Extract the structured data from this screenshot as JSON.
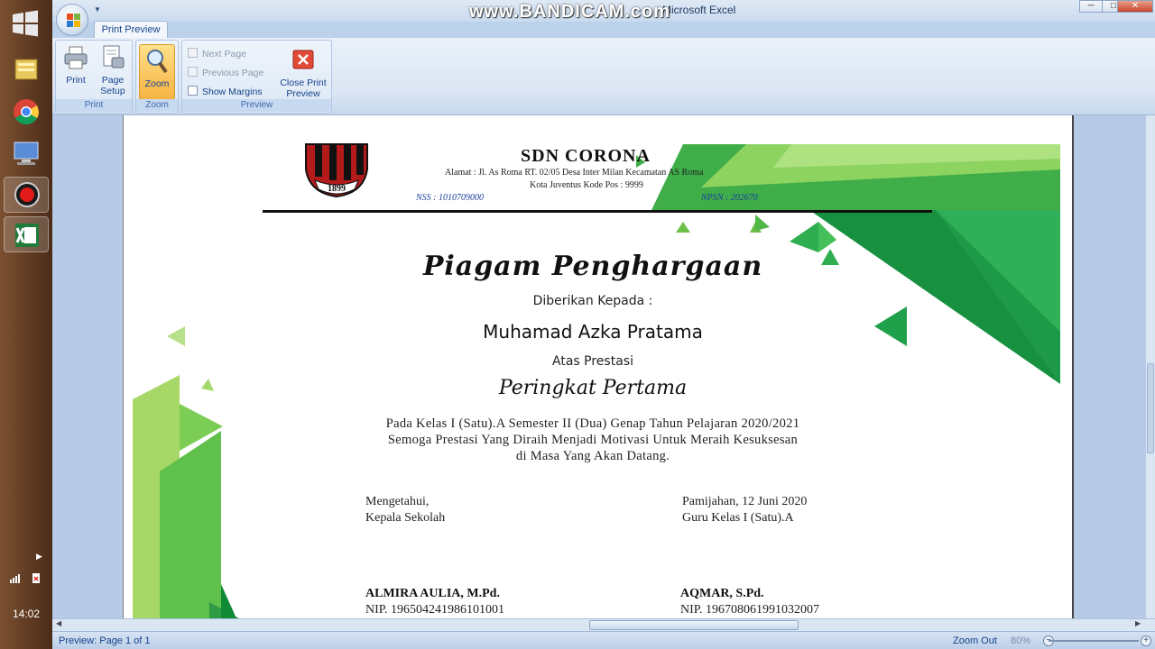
{
  "window": {
    "title": "Microsoft Excel",
    "overlay_watermark": "www.BANDICAM.com",
    "min_glyph": "─",
    "max_glyph": "□",
    "close_glyph": "✕"
  },
  "taskbar": {
    "clock": "14:02",
    "apps": [
      "file-manager-icon",
      "chrome-icon",
      "remote-desktop-icon",
      "record-icon",
      "excel-icon"
    ]
  },
  "ribbon": {
    "tab": "Print Preview",
    "groups": {
      "print": {
        "label": "Print",
        "print_btn": "Print",
        "page_setup_line1": "Page",
        "page_setup_line2": "Setup"
      },
      "zoom": {
        "label": "Zoom",
        "zoom_btn": "Zoom"
      },
      "preview": {
        "label": "Preview",
        "next_page": "Next Page",
        "previous_page": "Previous Page",
        "show_margins": "Show Margins",
        "close_line1": "Close Print",
        "close_line2": "Preview"
      }
    }
  },
  "certificate": {
    "school": "SDN CORONA",
    "address": "Alamat : Jl. As Roma RT. 02/05 Desa Inter Milan Kecamatan AS Roma",
    "city": "Kota Juventus  Kode Pos : 9999",
    "nss": "NSS : 1010709000",
    "npsn": "NPSN : 202670",
    "logo_year": "1899",
    "title": "Piagam Penghargaan",
    "given_to": "Diberikan Kepada :",
    "recipient": "Muhamad Azka Pratama",
    "for_achievement": "Atas Prestasi",
    "rank": "Peringkat Pertama",
    "body_line1": "Pada  Kelas   I (Satu).A   Semester  II (Dua) Genap Tahun Pelajaran 2020/2021",
    "body_line2": "Semoga Prestasi  Yang Diraih  Menjadi Motivasi Untuk Meraih Kesuksesan",
    "body_line3": "di Masa Yang Akan Datang.",
    "left_sign_label1": "Mengetahui,",
    "left_sign_label2": "Kepala Sekolah",
    "right_sign_label1": "Pamijahan, 12 Juni 2020",
    "right_sign_label2": "Guru Kelas    I (Satu).A",
    "left_signer": "ALMIRA AULIA, M.Pd.",
    "left_nip": "NIP. 196504241986101001",
    "right_signer": "AQMAR, S.Pd.",
    "right_nip": "NIP. 196708061991032007"
  },
  "status": {
    "left": "Preview: Page 1 of 1",
    "zoom_out": "Zoom Out",
    "zoom_pct": "80%",
    "minus": "−",
    "plus": "+"
  },
  "colors": {
    "accent_green": "#3fae49",
    "light_green": "#8dd35f",
    "ribbon_blue": "#15428b"
  }
}
